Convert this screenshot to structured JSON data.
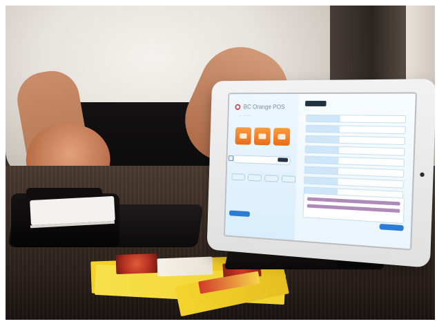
{
  "scene": {
    "tablet_screen": {
      "brand_text": "BC Orange POS"
    }
  }
}
